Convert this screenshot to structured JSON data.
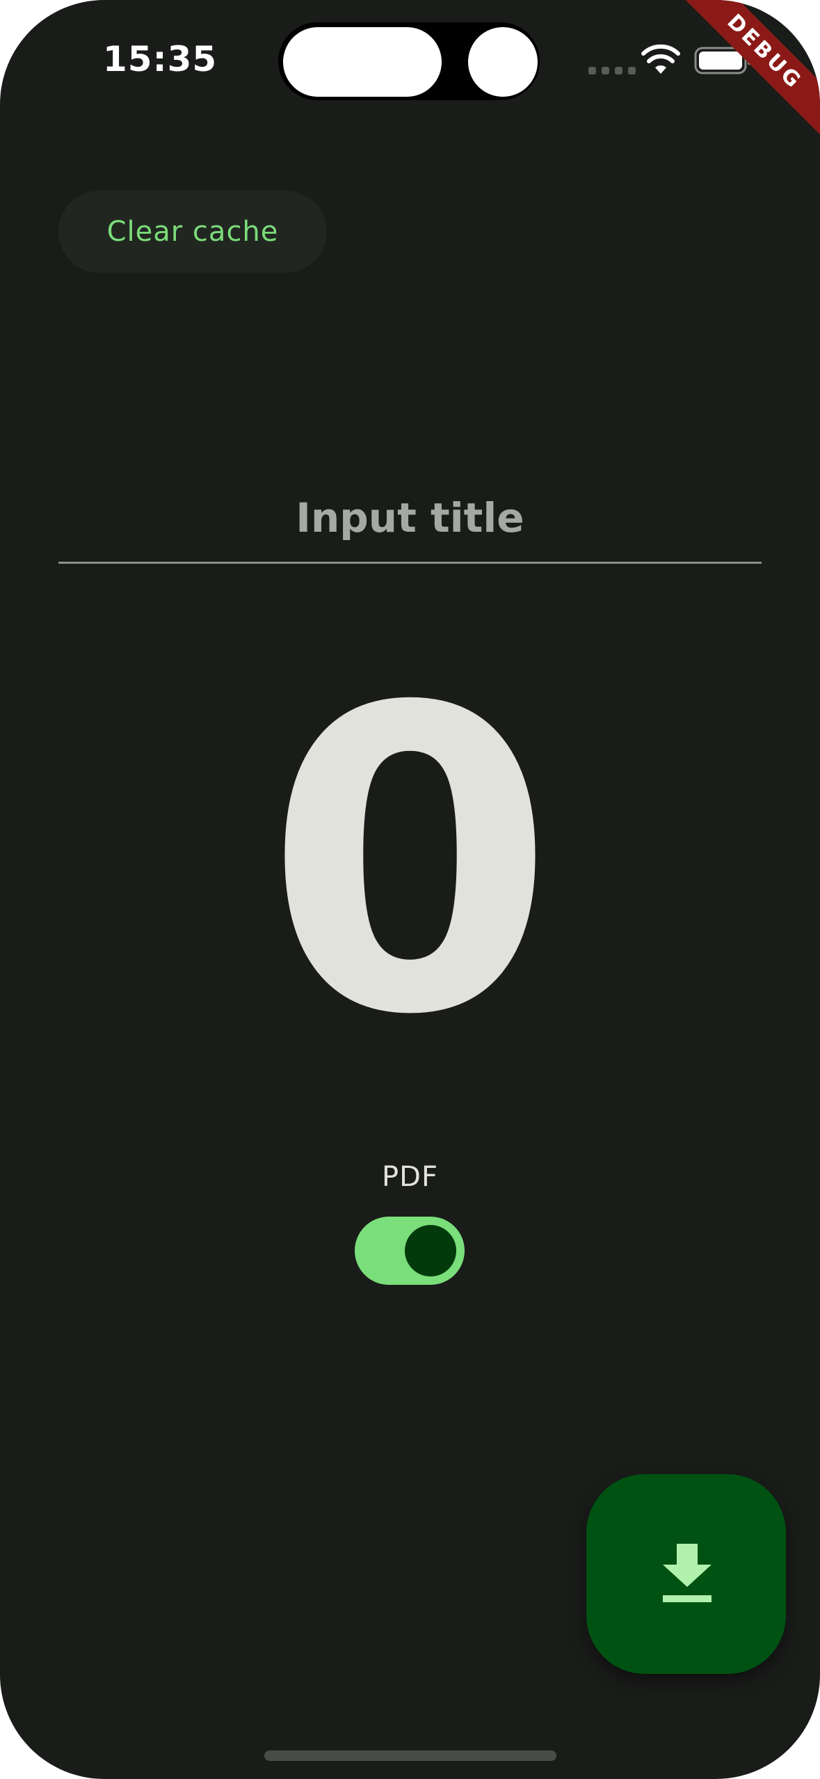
{
  "status_bar": {
    "time": "15:35"
  },
  "debug_banner": "DEBUG",
  "toolbar": {
    "clear_cache_label": "Clear cache"
  },
  "title_field": {
    "placeholder": "Input title",
    "value": ""
  },
  "counter": {
    "value": "0"
  },
  "pdf_toggle": {
    "label": "PDF",
    "on": true
  },
  "fab": {
    "icon": "download-icon"
  },
  "colors": {
    "background": "#1a1c1a",
    "accent": "#7cdc7a",
    "switch_track": "#7ade7b",
    "fab_background": "#005212",
    "fab_icon": "#b0f2ad",
    "debug_ribbon": "#8b1a17"
  }
}
